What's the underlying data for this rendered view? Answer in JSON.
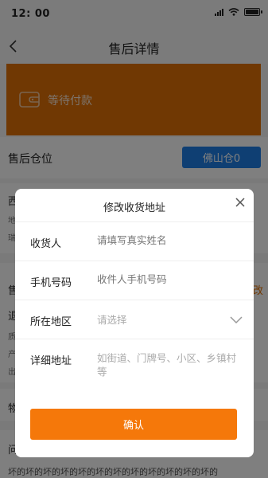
{
  "status_bar": {
    "time": "12: 00"
  },
  "nav": {
    "title": "售后详情"
  },
  "banner": {
    "status_text": "等待付款"
  },
  "warehouse": {
    "label": "售后仓位",
    "button_label": "佛山仓0"
  },
  "background": {
    "letter_1": "西",
    "small_1": "地",
    "small_2": "瑞",
    "letter_2": "售",
    "right_fragment": "改",
    "letter_3": "退",
    "small_3": "质",
    "small_4": "产",
    "small_5": "出",
    "letter_4": "物",
    "letter_5": "问",
    "bottom_text": "坏的坏的坏的坏的坏的坏的坏的坏的坏的坏的坏的坏的"
  },
  "modal": {
    "title": "修改收货地址",
    "fields": [
      {
        "label": "收货人",
        "placeholder": "请填写真实姓名"
      },
      {
        "label": "手机号码",
        "placeholder": "收件人手机号码"
      },
      {
        "label": "所在地区",
        "placeholder": "请选择"
      },
      {
        "label": "详细地址",
        "placeholder": "如街道、门牌号、小区、乡镇村等"
      }
    ],
    "confirm_label": "确认"
  },
  "colors": {
    "banner": "#e07106",
    "warehouse_button": "#1e7ee6",
    "confirm_button": "#f5780a"
  }
}
